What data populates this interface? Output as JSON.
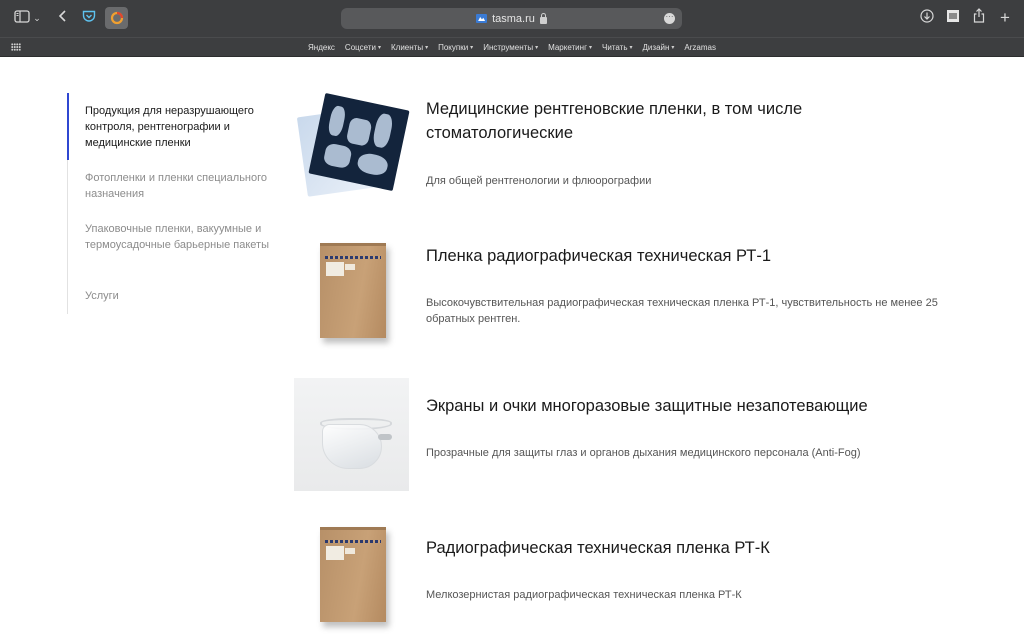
{
  "browser": {
    "url": "tasma.ru",
    "favorites": [
      {
        "label": "Яндекс",
        "has_menu": false
      },
      {
        "label": "Соцсети",
        "has_menu": true
      },
      {
        "label": "Клиенты",
        "has_menu": true
      },
      {
        "label": "Покупки",
        "has_menu": true
      },
      {
        "label": "Инструменты",
        "has_menu": true
      },
      {
        "label": "Маркетинг",
        "has_menu": true
      },
      {
        "label": "Читать",
        "has_menu": true
      },
      {
        "label": "Дизайн",
        "has_menu": true
      },
      {
        "label": "Arzamas",
        "has_menu": false
      }
    ],
    "icons": {
      "sidebar": "sidebar-icon",
      "back": "chevron-left-icon",
      "pocket": "pocket-icon",
      "extension": "extension-icon",
      "download": "download-icon",
      "share": "share-icon",
      "new_tab": "plus-icon"
    }
  },
  "sidebar": {
    "items": [
      {
        "label": "Продукция для неразрушающего контроля, рентгенографии и медицинские пленки",
        "active": true
      },
      {
        "label": "Фотопленки и пленки специального назначения",
        "active": false
      },
      {
        "label": "Упаковочные пленки, вакуумные и термоусадочные барьерные пакеты",
        "active": false
      },
      {
        "label": "Услуги",
        "active": false
      }
    ],
    "accent_color": "#2f47d1"
  },
  "products": [
    {
      "title": "Медицинские рентгеновские пленки, в том числе стоматологические",
      "description": "Для общей рентгенологии и флюорографии",
      "image": "xray-film-image"
    },
    {
      "title": "Пленка радиографическая техническая РТ-1",
      "description": "Высокочувствительная радиографическая техническая пленка РТ-1, чувствительность не менее 25 обратных рентген.",
      "image": "film-box-image"
    },
    {
      "title": "Экраны и очки многоразовые защитные незапотевающие",
      "description": "Прозрачные для защиты глаз и органов дыхания медицинского персонала (Anti-Fog)",
      "image": "face-shield-image"
    },
    {
      "title": "Радиографическая техническая пленка РТ-К",
      "description": "Мелкозернистая радиографическая техническая пленка РТ-К",
      "image": "film-box-image"
    }
  ]
}
